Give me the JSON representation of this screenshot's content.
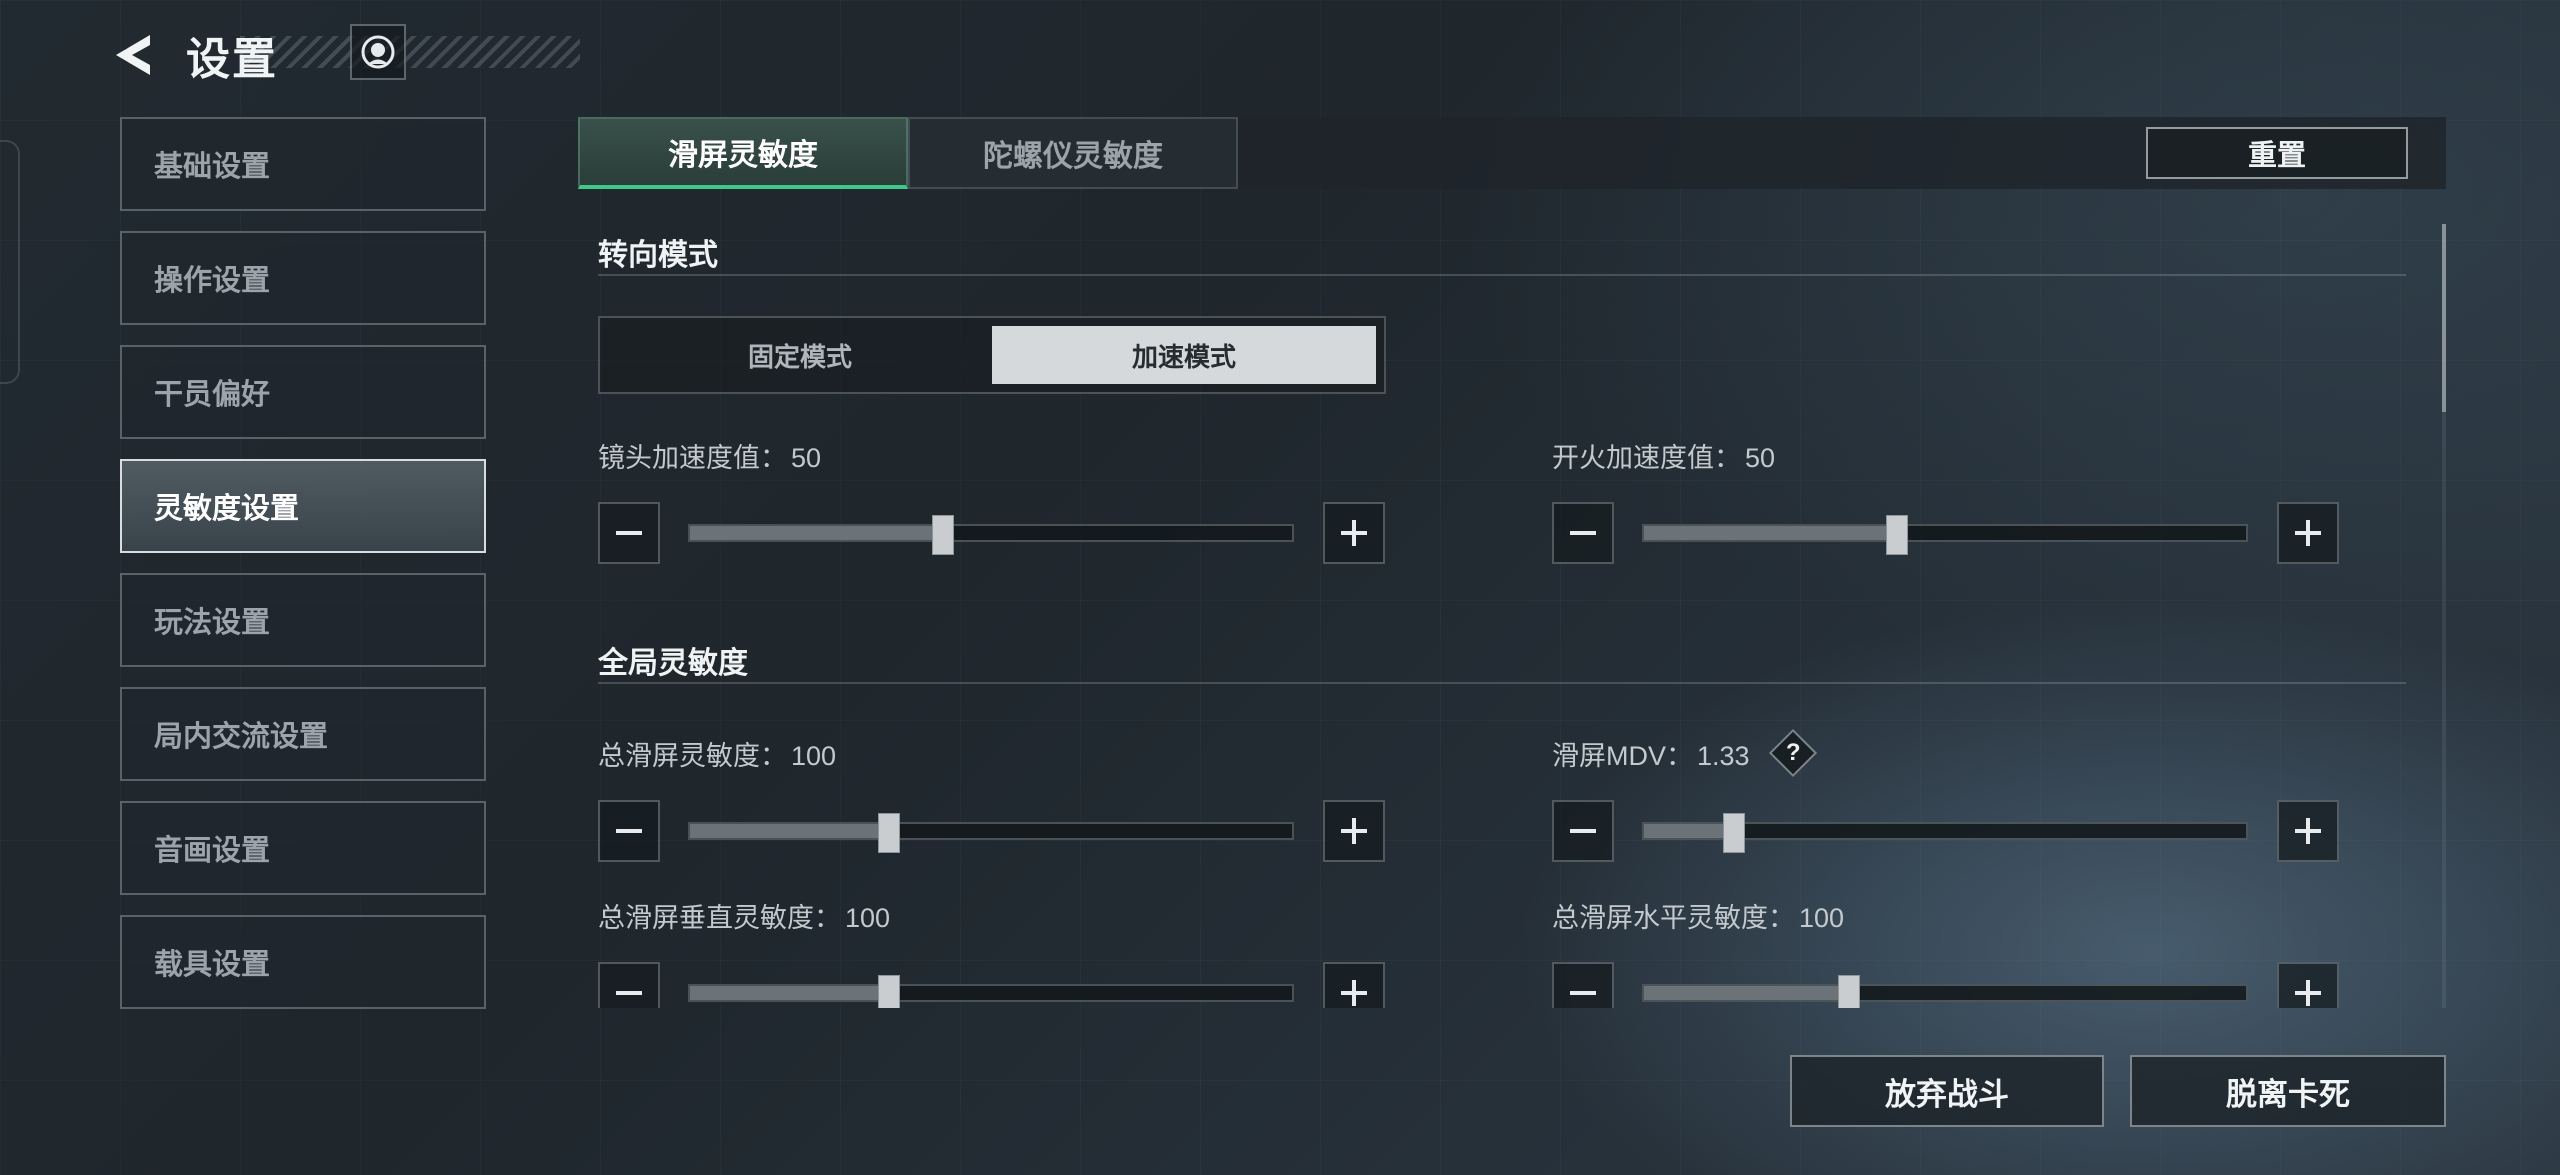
{
  "header": {
    "title": "设置",
    "back_icon": "back-arrow-icon",
    "feedback_icon": "customer-service-icon"
  },
  "sidebar": {
    "items": [
      {
        "label": "基础设置",
        "active": false
      },
      {
        "label": "操作设置",
        "active": false
      },
      {
        "label": "干员偏好",
        "active": false
      },
      {
        "label": "灵敏度设置",
        "active": true
      },
      {
        "label": "玩法设置",
        "active": false
      },
      {
        "label": "局内交流设置",
        "active": false
      },
      {
        "label": "音画设置",
        "active": false
      },
      {
        "label": "载具设置",
        "active": false
      }
    ]
  },
  "tabs": [
    {
      "label": "滑屏灵敏度",
      "active": true
    },
    {
      "label": "陀螺仪灵敏度",
      "active": false
    }
  ],
  "reset_label": "重置",
  "sections": {
    "turn_mode": {
      "title": "转向模式",
      "options": [
        "固定模式",
        "加速模式"
      ],
      "selected": "加速模式"
    },
    "global": {
      "title": "全局灵敏度"
    }
  },
  "sliders": {
    "lens_accel": {
      "label": "镜头加速度值：",
      "value": "50",
      "fill": 0.42
    },
    "fire_accel": {
      "label": "开火加速度值：",
      "value": "50",
      "fill": 0.42
    },
    "total_swipe": {
      "label": "总滑屏灵敏度：",
      "value": "100",
      "fill": 0.33
    },
    "swipe_mdv": {
      "label": "滑屏MDV：",
      "value": "1.33",
      "fill": 0.15
    },
    "total_vertical": {
      "label": "总滑屏垂直灵敏度：",
      "value": "100",
      "fill": 0.33
    },
    "total_horizontal": {
      "label": "总滑屏水平灵敏度：",
      "value": "100",
      "fill": 0.34
    }
  },
  "help_label": "?",
  "bottom": {
    "abandon_label": "放弃战斗",
    "unstuck_label": "脱离卡死"
  },
  "colors": {
    "accent": "#3ec98c",
    "selected_mode_bg": "#d6d9db"
  }
}
